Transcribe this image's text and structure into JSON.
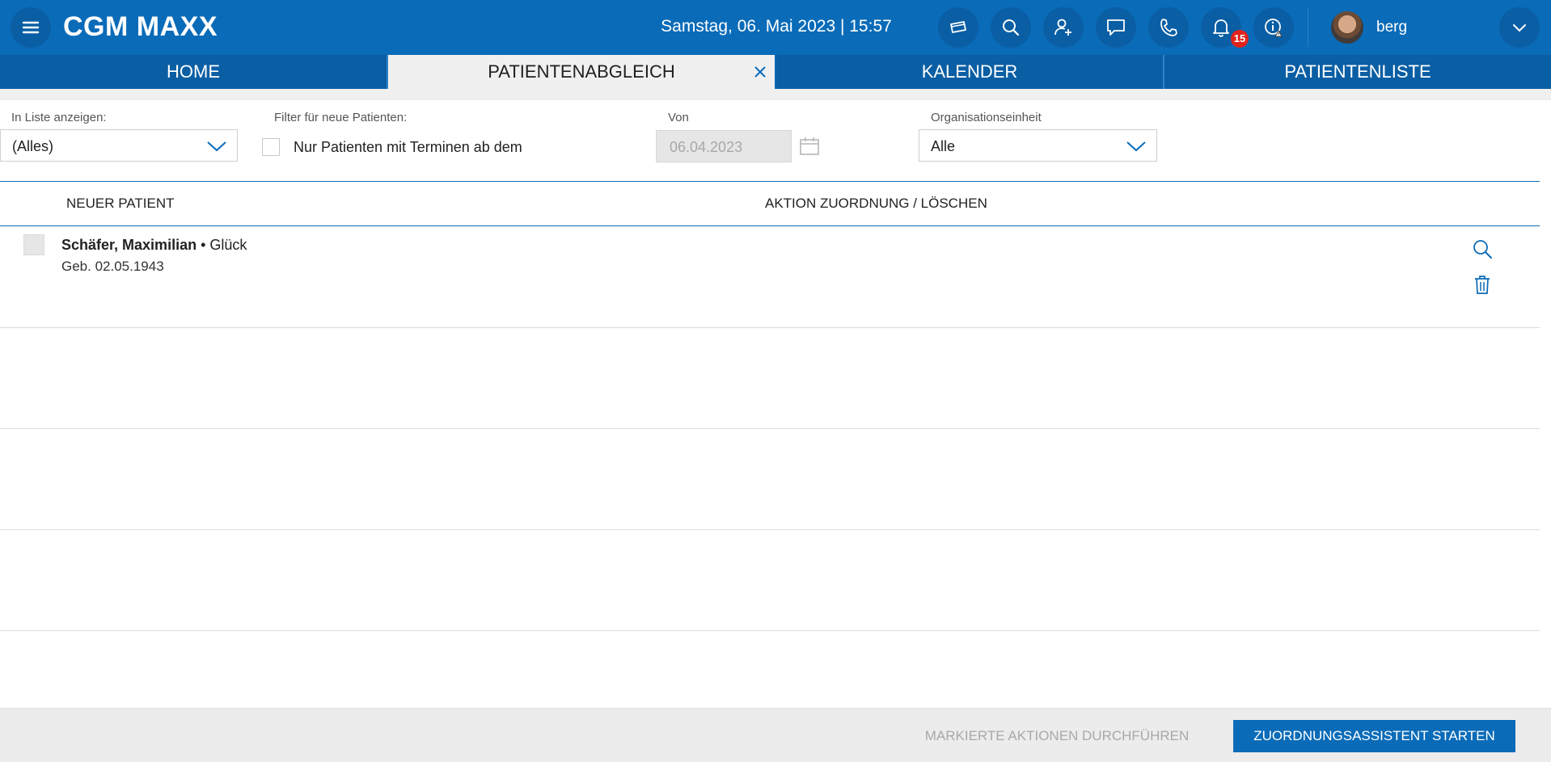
{
  "app": {
    "title": "CGM MAXX",
    "datetime": "Samstag, 06. Mai 2023 | 15:57",
    "user": "berg",
    "notification_count": "15"
  },
  "icons": {
    "menu": "menu-icon",
    "card": "card-icon",
    "search": "search-icon",
    "add_user": "add-user-icon",
    "chat": "chat-icon",
    "phone": "phone-icon",
    "bell": "bell-icon",
    "info": "info-warning-icon",
    "dropdown": "chevron-down-icon"
  },
  "tabs": [
    {
      "label": "HOME"
    },
    {
      "label": "PATIENTENABGLEICH",
      "active": true
    },
    {
      "label": "KALENDER"
    },
    {
      "label": "PATIENTENLISTE"
    }
  ],
  "filters": {
    "show_in_list_label": "In Liste anzeigen:",
    "show_in_list_value": "(Alles)",
    "new_patients_filter_label": "Filter für neue Patienten:",
    "only_with_appointments_label": "Nur Patienten mit Terminen ab dem",
    "from_label": "Von",
    "from_value": "06.04.2023",
    "org_unit_label": "Organisationseinheit",
    "org_unit_value": "Alle"
  },
  "table": {
    "headers": [
      "NEUER PATIENT",
      "AKTION ZUORDNUNG / LÖSCHEN"
    ],
    "rows": [
      {
        "name": "Schäfer, Maximilian",
        "extra": " • Glück",
        "birth": "Geb. 02.05.1943"
      }
    ]
  },
  "footer": {
    "execute_label": "MARKIERTE AKTIONEN DURCHFÜHREN",
    "assistant_label": "ZUORDNUNGSASSISTENT STARTEN"
  },
  "colors": {
    "primary": "#0a6bb8",
    "primary_dark": "#0a5ea4",
    "badge": "#e0231c",
    "tab_active_bg": "#f0f0f0"
  }
}
